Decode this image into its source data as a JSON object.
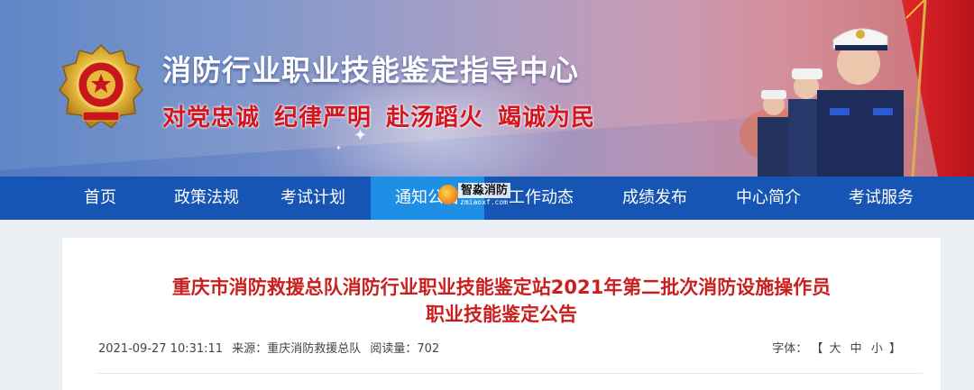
{
  "header": {
    "site_title": "消防行业职业技能鉴定指导中心",
    "slogans": [
      "对党忠诚",
      "纪律严明",
      "赴汤蹈火",
      "竭诚为民"
    ]
  },
  "nav": {
    "items": [
      {
        "label": "首页"
      },
      {
        "label": "政策法规"
      },
      {
        "label": "考试计划"
      },
      {
        "label": "通知公告"
      },
      {
        "label": "工作动态"
      },
      {
        "label": "成绩发布"
      },
      {
        "label": "中心简介"
      },
      {
        "label": "考试服务"
      }
    ],
    "active_index": 3
  },
  "watermark": {
    "text": "智淼消防",
    "url": "zmiaoxf.com"
  },
  "article": {
    "title_line1": "重庆市消防救援总队消防行业职业技能鉴定站2021年第二批次消防设施操作员",
    "title_line2": "职业技能鉴定公告",
    "datetime": "2021-09-27 10:31:11",
    "source_label": "来源：",
    "source": "重庆消防救援总队",
    "views_label": "阅读量：",
    "views": "702",
    "font_label": "字体：",
    "font_open": "【",
    "font_large": "大",
    "font_medium": "中",
    "font_small": "小",
    "font_close": "】"
  },
  "colors": {
    "nav_bg": "#1755b4",
    "nav_active": "#1f8fe6",
    "title_red": "#c9201f",
    "slogan_red": "#d5141d"
  },
  "icons": {
    "emblem": "national-fire-rescue-emblem",
    "watermark_logo": "watermark-logo-icon"
  }
}
